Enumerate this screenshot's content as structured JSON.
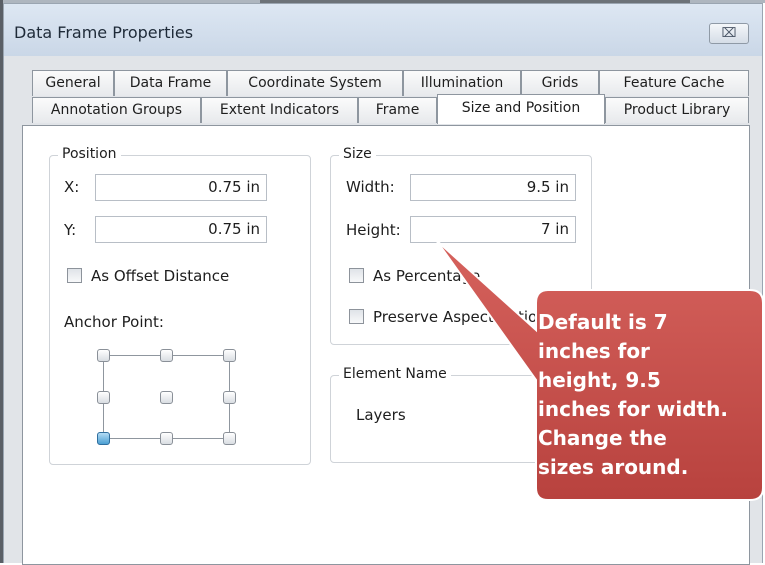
{
  "window": {
    "title": "Data Frame Properties",
    "close_glyph": "⌧",
    "close_icon": "close-icon"
  },
  "tabs": {
    "row1": [
      "General",
      "Data Frame",
      "Coordinate System",
      "Illumination",
      "Grids",
      "Feature Cache"
    ],
    "row2": [
      "Annotation Groups",
      "Extent Indicators",
      "Frame",
      "Size and Position",
      "Product Library"
    ],
    "active": "Size and Position"
  },
  "position": {
    "legend": "Position",
    "x_label": "X:",
    "x_value": "0.75 in",
    "y_label": "Y:",
    "y_value": "0.75 in",
    "offset_label": "As Offset Distance",
    "offset_checked": false,
    "anchor_label": "Anchor Point:",
    "anchor_selected": "bottom-left"
  },
  "size": {
    "legend": "Size",
    "width_label": "Width:",
    "width_value": "9.5 in",
    "height_label": "Height:",
    "height_value": "7 in",
    "percentage_label": "As Percentage",
    "percentage_checked": false,
    "aspect_label": "Preserve Aspect Ratio",
    "aspect_checked": false
  },
  "element_name": {
    "legend": "Element Name",
    "value": "Layers"
  },
  "callout": {
    "lines": [
      "Default is 7",
      "inches for",
      "height, 9.5",
      "inches for width.",
      "Change the",
      "sizes around."
    ],
    "fill_color": "#c0504d"
  }
}
